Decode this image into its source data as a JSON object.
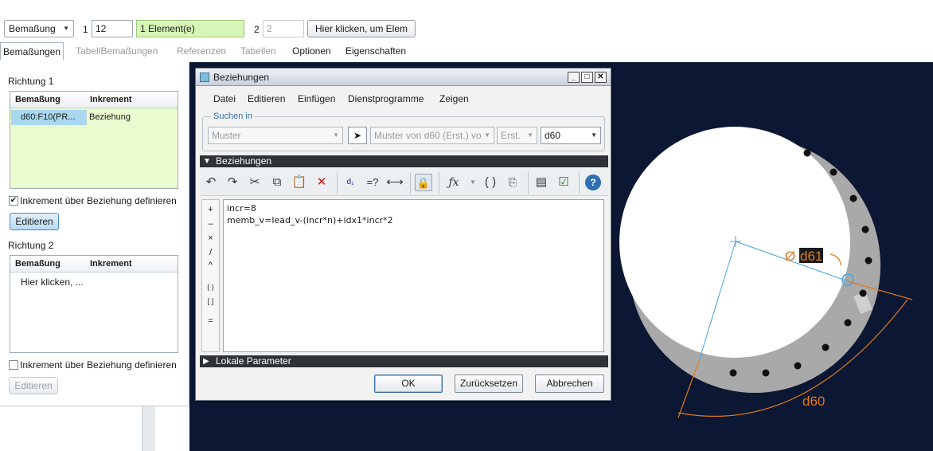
{
  "dashboard": {
    "type_select": "Bemaßung",
    "dir1_number": "1",
    "dir1_count": "12",
    "dir1_elements": "1 Element(e)",
    "dir2_number": "2",
    "dir2_count": "2",
    "dir2_click_button": "Hier klicken, um Elem"
  },
  "tabs": [
    "Bemaßungen",
    "TabellBemaßungen",
    "Referenzen",
    "Tabellen",
    "Optionen",
    "Eigenschaften"
  ],
  "panel": {
    "dir1_title": "Richtung 1",
    "dir1_table": {
      "col1": "Bemaßung",
      "col2": "Inkrement",
      "rows": [
        {
          "dim": "d60:F10(PR...",
          "increment": "Beziehung"
        }
      ]
    },
    "dir1_checkbox_label": "Inkrement über Beziehung definieren",
    "dir1_checkbox_checked": true,
    "dir1_edit_button": "Editieren",
    "dir2_title": "Richtung 2",
    "dir2_table": {
      "col1": "Bemaßung",
      "col2": "Inkrement",
      "placeholder": "Hier klicken, ..."
    },
    "dir2_checkbox_label": "Inkrement über Beziehung definieren",
    "dir2_checkbox_checked": false,
    "dir2_edit_button": "Editieren"
  },
  "dialog": {
    "title": "Beziehungen",
    "window_buttons": [
      "_",
      "□",
      "✕"
    ],
    "menus": [
      "Datei",
      "Editieren",
      "Einfügen",
      "Dienstprogramme",
      "Zeigen"
    ],
    "search_group": "Suchen in",
    "search_scope": "Muster",
    "search_object": "Muster von d60 (Erst.) vo",
    "search_type": "Erst.",
    "search_dim": "d60",
    "relations_section": "Beziehungen",
    "operators": [
      "+",
      "–",
      "×",
      "/",
      "^",
      "( )",
      "[ ]",
      "="
    ],
    "relations": [
      "incr=8",
      "memb_v=lead_v-(incr*n)+idx1*incr*2"
    ],
    "local_params_section": "Lokale Parameter",
    "ok_button": "OK",
    "reset_button": "Zurücksetzen",
    "cancel_button": "Abbrechen"
  },
  "model": {
    "dim_diameter": "d61",
    "dim_angle": "d60",
    "diameter_symbol": "Ø"
  },
  "colors": {
    "background": "#0c1733",
    "dimension": "#e07a1e",
    "axis": "#4aa3e0",
    "part": "#ffffff"
  }
}
